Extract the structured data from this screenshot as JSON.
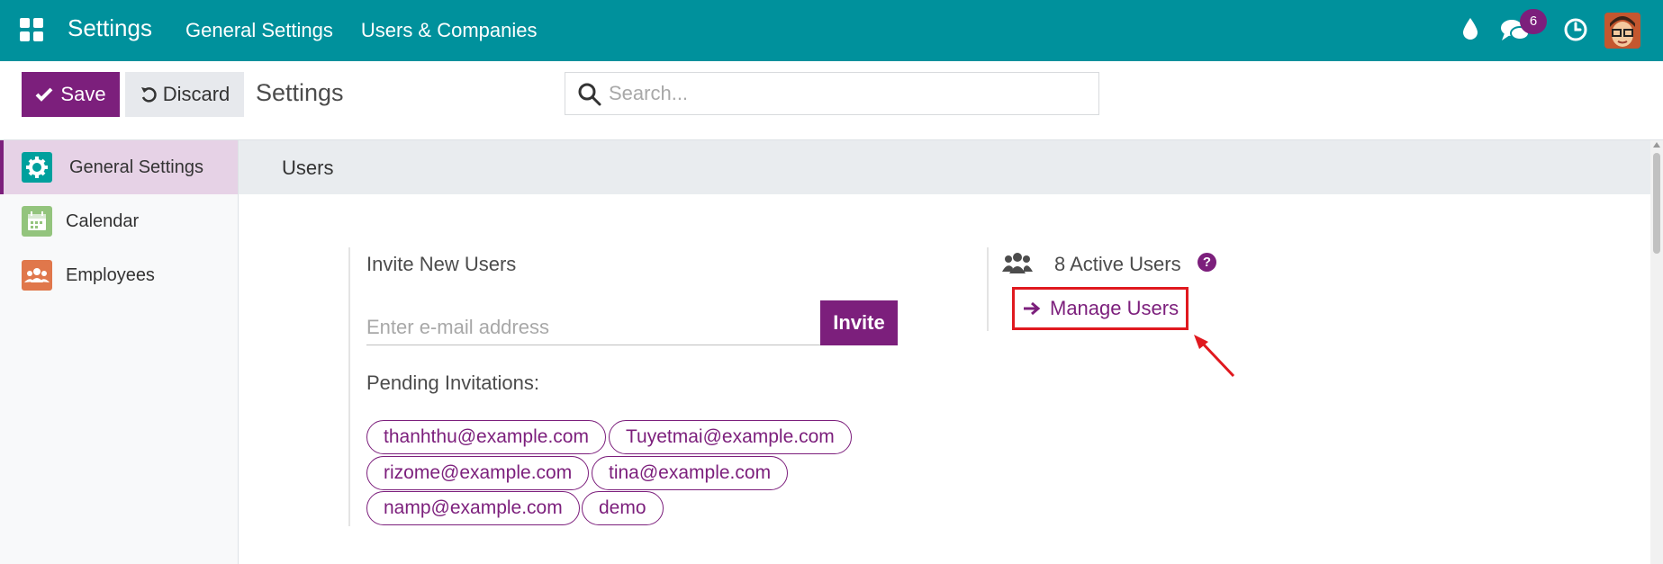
{
  "navbar": {
    "brand": "Settings",
    "menu": [
      "General Settings",
      "Users & Companies"
    ],
    "chat_badge": "6",
    "icons": [
      "apps-icon",
      "drop-icon",
      "chat-icon",
      "clock-icon",
      "avatar"
    ]
  },
  "control_panel": {
    "save_label": "Save",
    "discard_label": "Discard",
    "title": "Settings",
    "search_placeholder": "Search..."
  },
  "sidebar": {
    "items": [
      {
        "label": "General Settings",
        "icon": "gear-icon",
        "color": "#00a09d",
        "active": true
      },
      {
        "label": "Calendar",
        "icon": "calendar-icon",
        "color": "#93c47d",
        "active": false
      },
      {
        "label": "Employees",
        "icon": "employees-icon",
        "color": "#e0774b",
        "active": false
      }
    ]
  },
  "section": {
    "title": "Users"
  },
  "invite": {
    "title": "Invite New Users",
    "email_placeholder": "Enter e-mail address",
    "invite_label": "Invite",
    "pending_title": "Pending Invitations:",
    "pending": [
      "thanhthu@example.com",
      "Tuyetmai@example.com",
      "rizome@example.com",
      "tina@example.com",
      "namp@example.com",
      "demo"
    ]
  },
  "users": {
    "active_users": "8 Active Users",
    "manage_users": "Manage Users"
  },
  "colors": {
    "navbar": "#00919c",
    "primary": "#7c1f7c",
    "highlight": "#e0191f"
  }
}
